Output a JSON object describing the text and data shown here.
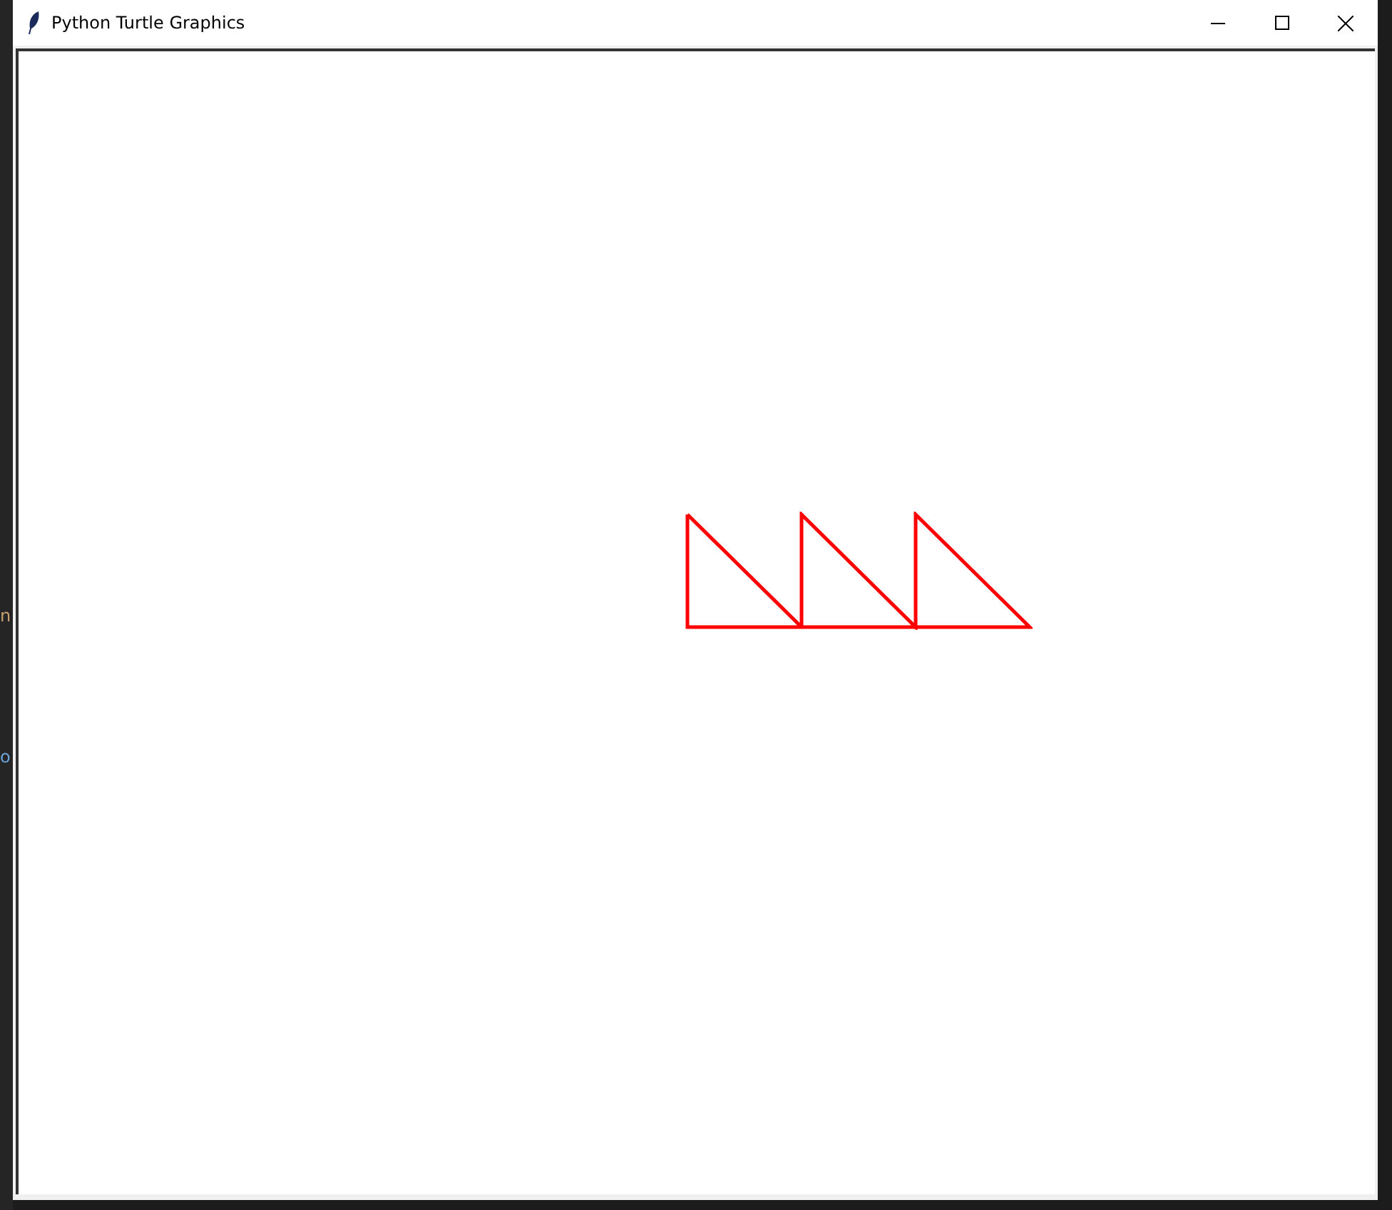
{
  "background_window": {
    "fragments": [
      {
        "text": "n",
        "color": "#c8a070"
      },
      {
        "text": "o",
        "color": "#6ca6d8"
      }
    ]
  },
  "window": {
    "title": "Python Turtle Graphics"
  }
}
